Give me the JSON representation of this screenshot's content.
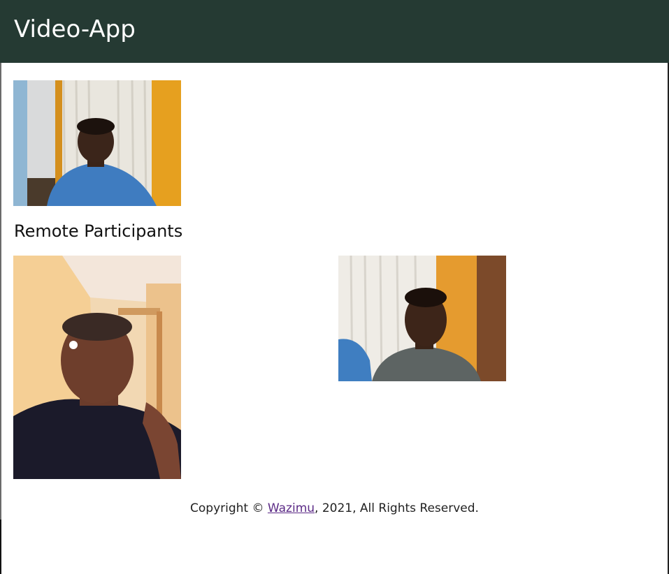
{
  "header": {
    "title": "Video-App"
  },
  "local": {
    "video_icon": "local-participant-video"
  },
  "remote": {
    "section_title": "Remote Participants",
    "participants": [
      {
        "video_icon": "remote-participant-video"
      },
      {
        "video_icon": "remote-participant-video"
      }
    ]
  },
  "footer": {
    "prefix": "Copyright © ",
    "link_text": "Wazimu",
    "suffix": ", 2021, All Rights Reserved."
  },
  "colors": {
    "header_bg": "#253a33",
    "header_text": "#ffffff",
    "link": "#5b2a86"
  }
}
